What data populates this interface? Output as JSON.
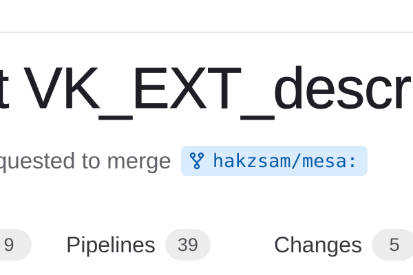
{
  "merge_request": {
    "title": "t VK_EXT_descrip",
    "requested_text": "quested to merge",
    "source_branch": "hakzsam/mesa:"
  },
  "tabs": [
    {
      "label": "",
      "count": "9"
    },
    {
      "label": "Pipelines",
      "count": "39"
    },
    {
      "label": "Changes",
      "count": "5"
    }
  ],
  "colors": {
    "branch_pill_bg": "#d9ecfd",
    "branch_text": "#0b5cad",
    "count_badge_bg": "#ececef"
  },
  "icons": {
    "branch": "fork-icon"
  }
}
